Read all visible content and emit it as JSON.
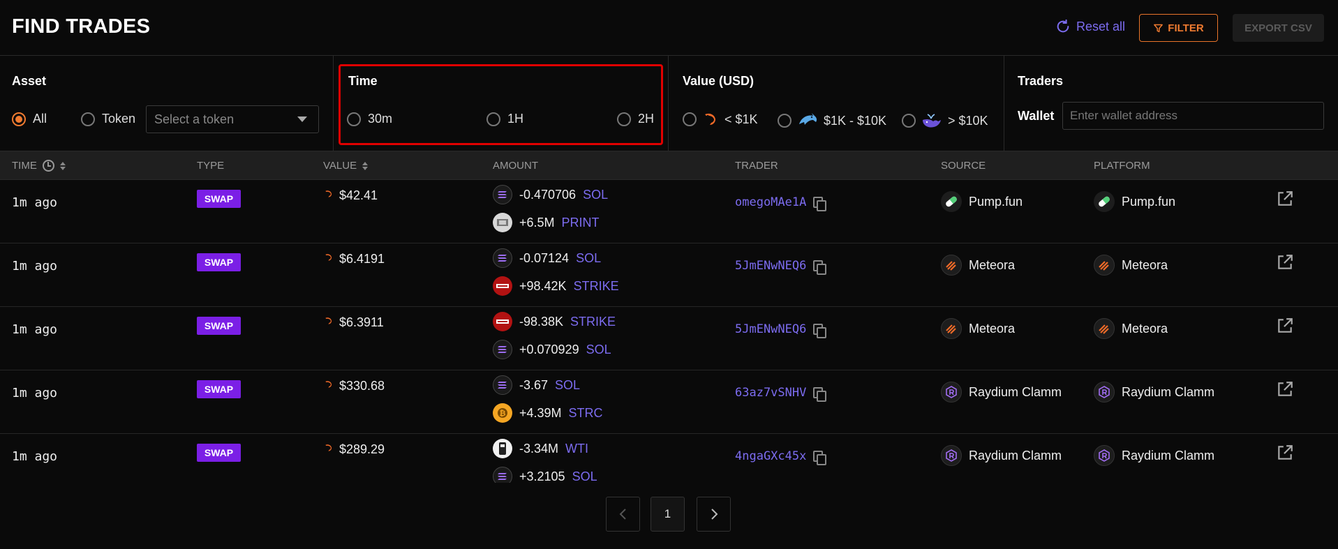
{
  "header": {
    "title": "FIND TRADES",
    "reset_label": "Reset all",
    "filter_label": "FILTER",
    "export_label": "EXPORT CSV"
  },
  "filters": {
    "asset": {
      "label": "Asset",
      "options": [
        {
          "label": "All",
          "selected": true
        },
        {
          "label": "Token",
          "selected": false
        }
      ],
      "token_select_placeholder": "Select a token"
    },
    "time": {
      "label": "Time",
      "options": [
        {
          "label": "30m",
          "selected": false
        },
        {
          "label": "1H",
          "selected": false
        },
        {
          "label": "2H",
          "selected": false
        }
      ]
    },
    "value": {
      "label": "Value (USD)",
      "options": [
        {
          "label": "< $1K",
          "icon": "shrimp-icon",
          "selected": false
        },
        {
          "label": "$1K - $10K",
          "icon": "dolphin-icon",
          "selected": false
        },
        {
          "label": "> $10K",
          "icon": "whale-icon",
          "selected": false
        }
      ]
    },
    "traders": {
      "label": "Traders",
      "wallet_label": "Wallet",
      "wallet_placeholder": "Enter wallet address"
    }
  },
  "table": {
    "columns": [
      "TIME",
      "TYPE",
      "VALUE",
      "AMOUNT",
      "TRADER",
      "SOURCE",
      "PLATFORM"
    ],
    "rows": [
      {
        "time": "1m ago",
        "type": "SWAP",
        "value": "$42.41",
        "amounts": [
          {
            "amount": "-0.470706",
            "symbol": "SOL",
            "icon": "solana-icon"
          },
          {
            "amount": "+6.5M",
            "symbol": "PRINT",
            "icon": "print-token-icon"
          }
        ],
        "trader": "omegoMAe1A",
        "source": "Pump.fun",
        "source_icon": "pump-fun-icon",
        "platform": "Pump.fun",
        "platform_icon": "pump-fun-icon"
      },
      {
        "time": "1m ago",
        "type": "SWAP",
        "value": "$6.4191",
        "amounts": [
          {
            "amount": "-0.07124",
            "symbol": "SOL",
            "icon": "solana-icon"
          },
          {
            "amount": "+98.42K",
            "symbol": "STRIKE",
            "icon": "strike-token-icon"
          }
        ],
        "trader": "5JmENwNEQ6",
        "source": "Meteora",
        "source_icon": "meteora-icon",
        "platform": "Meteora",
        "platform_icon": "meteora-icon"
      },
      {
        "time": "1m ago",
        "type": "SWAP",
        "value": "$6.3911",
        "amounts": [
          {
            "amount": "-98.38K",
            "symbol": "STRIKE",
            "icon": "strike-token-icon"
          },
          {
            "amount": "+0.070929",
            "symbol": "SOL",
            "icon": "solana-icon"
          }
        ],
        "trader": "5JmENwNEQ6",
        "source": "Meteora",
        "source_icon": "meteora-icon",
        "platform": "Meteora",
        "platform_icon": "meteora-icon"
      },
      {
        "time": "1m ago",
        "type": "SWAP",
        "value": "$330.68",
        "amounts": [
          {
            "amount": "-3.67",
            "symbol": "SOL",
            "icon": "solana-icon"
          },
          {
            "amount": "+4.39M",
            "symbol": "STRC",
            "icon": "strc-token-icon"
          }
        ],
        "trader": "63az7vSNHV",
        "source": "Raydium Clamm",
        "source_icon": "raydium-icon",
        "platform": "Raydium Clamm",
        "platform_icon": "raydium-icon"
      },
      {
        "time": "1m ago",
        "type": "SWAP",
        "value": "$289.29",
        "amounts": [
          {
            "amount": "-3.34M",
            "symbol": "WTI",
            "icon": "wti-token-icon"
          },
          {
            "amount": "+3.2105",
            "symbol": "SOL",
            "icon": "solana-icon"
          }
        ],
        "trader": "4ngaGXc45x",
        "source": "Raydium Clamm",
        "source_icon": "raydium-icon",
        "platform": "Raydium Clamm",
        "platform_icon": "raydium-icon"
      }
    ]
  },
  "pagination": {
    "current_page": "1"
  },
  "colors": {
    "accent_orange": "#f07b30",
    "accent_purple": "#7c6cf0",
    "swap_badge": "#7b1fe6",
    "highlight_red": "#e00000"
  }
}
